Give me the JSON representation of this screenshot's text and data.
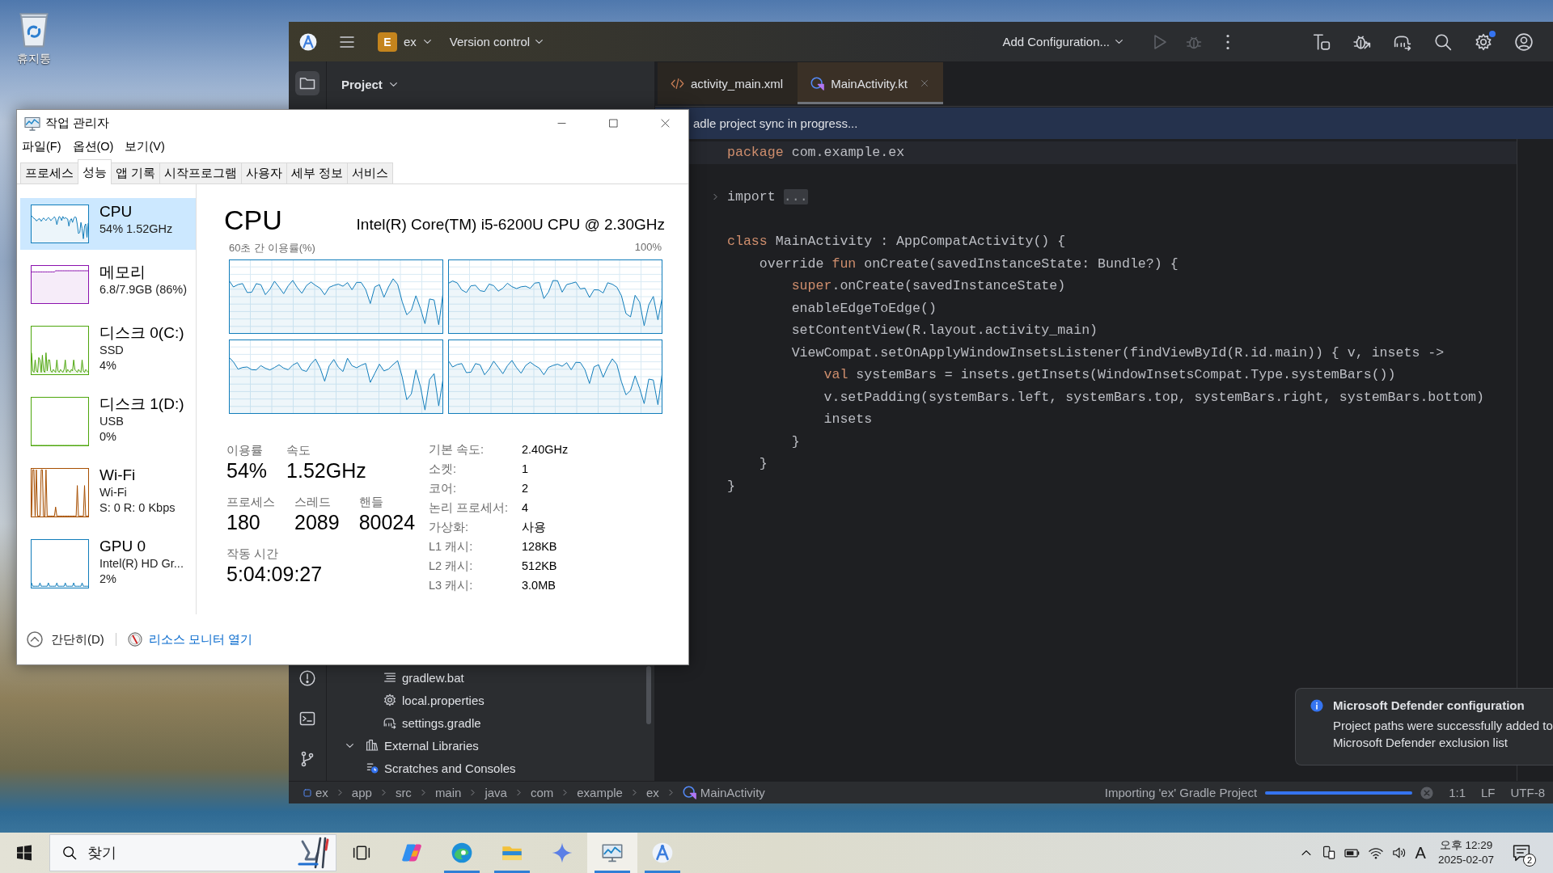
{
  "desktop": {
    "icons": [
      {
        "kind": "recycle_bin",
        "label": "휴지통"
      }
    ]
  },
  "ide": {
    "toolbar": {
      "project_initial": "E",
      "project_name": "ex",
      "vcs": "Version control",
      "run_config": "Add Configuration...",
      "actions": [
        {
          "kind": "run",
          "disabled": true
        },
        {
          "kind": "debug",
          "disabled": true
        },
        {
          "kind": "more",
          "disabled": false
        }
      ],
      "tools": [
        {
          "kind": "build",
          "badge": false
        },
        {
          "kind": "attach_debugger",
          "badge": false
        },
        {
          "kind": "gradle_sync",
          "badge": false
        },
        {
          "kind": "search",
          "badge": false
        },
        {
          "kind": "settings",
          "badge": true
        },
        {
          "kind": "account",
          "badge": false
        }
      ]
    },
    "tool_strip": {
      "top": [
        {
          "kind": "project",
          "selected": true
        }
      ],
      "bottom": [
        {
          "kind": "problems",
          "selected": false
        },
        {
          "kind": "terminal",
          "selected": false
        },
        {
          "kind": "vcs",
          "selected": false
        }
      ]
    },
    "project_panel": {
      "title": "Project",
      "tree": [
        {
          "children": [
            {
              "kind": "script",
              "label": "gradlew.bat"
            },
            {
              "kind": "properties",
              "label": "local.properties"
            },
            {
              "kind": "gradle",
              "label": "settings.gradle"
            }
          ]
        },
        {
          "kind": "library",
          "label": "External Libraries",
          "expanded": true
        },
        {
          "kind": "scratch",
          "label": "Scratches and Consoles"
        }
      ]
    },
    "editor": {
      "tabs": [
        {
          "kind": "xml",
          "label": "activity_main.xml",
          "selected": false
        },
        {
          "kind": "kotlin",
          "label": "MainActivity.kt",
          "selected": true
        }
      ],
      "banner": "adle project sync in progress...",
      "lines": [
        {
          "kind": "code",
          "current": true,
          "tokens": [
            {
              "kind": "keyword",
              "text": "package"
            },
            {
              "kind": "plain",
              "text": " com.example.ex"
            }
          ]
        },
        {
          "kind": "blank",
          "current": false
        },
        {
          "kind": "folded",
          "current": false,
          "tokens": [
            {
              "kind": "plain",
              "text": "import"
            }
          ],
          "fold_text": "..."
        },
        {
          "kind": "blank",
          "current": false
        },
        {
          "kind": "code",
          "current": false,
          "tokens": [
            {
              "kind": "keyword",
              "text": "class"
            },
            {
              "kind": "plain",
              "text": " MainActivity : AppCompatActivity() {"
            }
          ]
        },
        {
          "kind": "code",
          "current": false,
          "tokens": [
            {
              "kind": "plain",
              "text": "    override "
            },
            {
              "kind": "keyword",
              "text": "fun"
            },
            {
              "kind": "plain",
              "text": " onCreate(savedInstanceState: Bundle?) {"
            }
          ]
        },
        {
          "kind": "code",
          "current": false,
          "tokens": [
            {
              "kind": "keyword",
              "text": "        super"
            },
            {
              "kind": "plain",
              "text": ".onCreate(savedInstanceState)"
            }
          ]
        },
        {
          "kind": "code",
          "current": false,
          "tokens": [
            {
              "kind": "plain",
              "text": "        enableEdgeToEdge()"
            }
          ]
        },
        {
          "kind": "code",
          "current": false,
          "tokens": [
            {
              "kind": "plain",
              "text": "        setContentView(R.layout.activity_main)"
            }
          ]
        },
        {
          "kind": "code",
          "current": false,
          "tokens": [
            {
              "kind": "plain",
              "text": "        ViewCompat.setOnApplyWindowInsetsListener(findViewById(R.id.main)) { v, insets ->"
            }
          ]
        },
        {
          "kind": "code",
          "current": false,
          "tokens": [
            {
              "kind": "keyword",
              "text": "            val"
            },
            {
              "kind": "plain",
              "text": " systemBars = insets.getInsets(WindowInsetsCompat.Type.systemBars())"
            }
          ]
        },
        {
          "kind": "code",
          "current": false,
          "tokens": [
            {
              "kind": "plain",
              "text": "            v.setPadding(systemBars.left, systemBars.top, systemBars.right, systemBars.bottom)"
            }
          ]
        },
        {
          "kind": "code",
          "current": false,
          "tokens": [
            {
              "kind": "plain",
              "text": "            insets"
            }
          ]
        },
        {
          "kind": "code",
          "current": false,
          "tokens": [
            {
              "kind": "plain",
              "text": "        }"
            }
          ]
        },
        {
          "kind": "code",
          "current": false,
          "tokens": [
            {
              "kind": "plain",
              "text": "    }"
            }
          ]
        },
        {
          "kind": "code",
          "current": false,
          "tokens": [
            {
              "kind": "plain",
              "text": "}"
            }
          ]
        }
      ]
    },
    "status_bar": {
      "breadcrumbs": [
        {
          "kind": "module",
          "label": "ex"
        },
        {
          "kind": "folder",
          "label": "app"
        },
        {
          "kind": "folder",
          "label": "src"
        },
        {
          "kind": "folder",
          "label": "main"
        },
        {
          "kind": "folder",
          "label": "java"
        },
        {
          "kind": "folder",
          "label": "com"
        },
        {
          "kind": "folder",
          "label": "example"
        },
        {
          "kind": "folder",
          "label": "ex"
        },
        {
          "kind": "class",
          "label": "MainActivity"
        }
      ],
      "task": "Importing 'ex' Gradle Project",
      "progress": {
        "level": 1
      },
      "position": "1:1",
      "line_separator": "LF",
      "encoding": "UTF-8"
    }
  },
  "notification": {
    "title": "Microsoft Defender configuration",
    "lines": [
      "Project paths were successfully added to",
      "Microsoft Defender exclusion list"
    ]
  },
  "task_manager": {
    "title": "작업 관리자",
    "menu": [
      "파일(F)",
      "옵션(O)",
      "보기(V)"
    ],
    "tabs": [
      {
        "label": "프로세스",
        "selected": false
      },
      {
        "label": "성능",
        "selected": true
      },
      {
        "label": "앱 기록",
        "selected": false
      },
      {
        "label": "시작프로그램",
        "selected": false
      },
      {
        "label": "사용자",
        "selected": false
      },
      {
        "label": "세부 정보",
        "selected": false
      },
      {
        "label": "서비스",
        "selected": false
      }
    ],
    "resources": [
      {
        "title": "CPU",
        "details": [
          "54% 1.52GHz"
        ],
        "color": "#117dbb",
        "selected": true
      },
      {
        "title": "메모리",
        "details": [
          "6.8/7.9GB (86%)"
        ],
        "color": "#8b12ae",
        "selected": false
      },
      {
        "title": "디스크 0(C:)",
        "details": [
          "SSD",
          "4%"
        ],
        "color": "#4da60c",
        "selected": false
      },
      {
        "title": "디스크 1(D:)",
        "details": [
          "USB",
          "0%"
        ],
        "color": "#4da60c",
        "selected": false
      },
      {
        "title": "Wi-Fi",
        "details": [
          "Wi-Fi",
          "S: 0 R: 0 Kbps"
        ],
        "color": "#a74f01",
        "selected": false
      },
      {
        "title": "GPU 0",
        "details": [
          "Intel(R) HD Gr...",
          "2%"
        ],
        "color": "#117dbb",
        "selected": false
      }
    ],
    "detail": {
      "title": "CPU",
      "model": "Intel(R) Core(TM) i5-6200U CPU @ 2.30GHz",
      "graph_caption": "60초 간 이용률(%)",
      "graph_max": "100%",
      "stat_rows": [
        {
          "items": [
            {
              "label": "이용률",
              "value": "54%"
            },
            {
              "label": "속도",
              "value": "1.52GHz"
            }
          ]
        },
        {
          "items": [
            {
              "label": "프로세스",
              "value": "180"
            },
            {
              "label": "스레드",
              "value": "2089"
            },
            {
              "label": "핸들",
              "value": "80024"
            }
          ]
        },
        {
          "items": [
            {
              "label": "작동 시간",
              "value": "5:04:09:27"
            }
          ]
        }
      ],
      "specs": [
        {
          "label": "기본 속도:",
          "value": "2.40GHz"
        },
        {
          "label": "소켓:",
          "value": "1"
        },
        {
          "label": "코어:",
          "value": "2"
        },
        {
          "label": "논리 프로세서:",
          "value": "4"
        },
        {
          "label": "가상화:",
          "value": "사용"
        },
        {
          "label": "L1 캐시:",
          "value": "128KB"
        },
        {
          "label": "L2 캐시:",
          "value": "512KB"
        },
        {
          "label": "L3 캐시:",
          "value": "3.0MB"
        }
      ]
    },
    "footer": {
      "collapse": "간단히(D)",
      "link": "리소스 모니터 열기"
    }
  },
  "taskbar": {
    "search": {
      "placeholder": "찾기"
    },
    "apps": [
      {
        "kind": "task_view",
        "running": false,
        "active": false
      },
      {
        "kind": "copilot",
        "running": false,
        "active": false
      },
      {
        "kind": "edge",
        "running": true,
        "active": false
      },
      {
        "kind": "explorer",
        "running": true,
        "active": false
      },
      {
        "kind": "sparkle",
        "running": false,
        "active": false
      },
      {
        "kind": "task_manager",
        "running": true,
        "active": true
      },
      {
        "kind": "android_studio",
        "running": true,
        "active": false
      }
    ],
    "tray": {
      "input_mode": "A",
      "time": "오후 12:29",
      "date": "2025-02-07",
      "notification_count": "2"
    }
  }
}
